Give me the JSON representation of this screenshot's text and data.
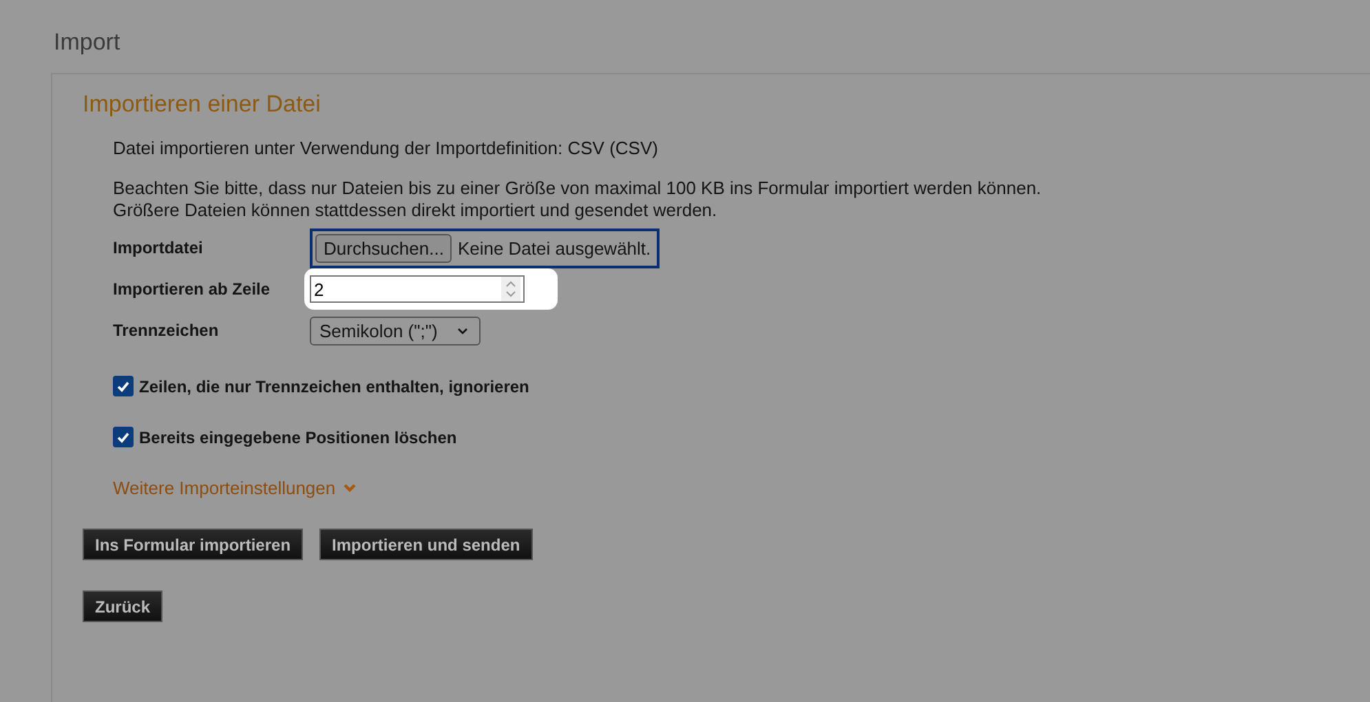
{
  "page_title": "Import",
  "panel": {
    "title": "Importieren einer Datei",
    "intro": "Datei importieren unter Verwendung der Importdefinition: CSV (CSV)",
    "notice": [
      "Beachten Sie bitte, dass nur Dateien bis zu einer Größe von maximal 100 KB ins Formular importiert werden können.",
      "Größere Dateien können stattdessen direkt importiert und gesendet werden."
    ],
    "fields": [
      {
        "kind": "file",
        "label": "Importdatei",
        "button": "Durchsuchen...",
        "value": "Keine Datei ausgewählt.",
        "focused": true,
        "highlighted": false
      },
      {
        "kind": "number",
        "label": "Importieren ab Zeile",
        "value": "2",
        "highlighted": true
      },
      {
        "kind": "select",
        "label": "Trennzeichen",
        "value": "Semikolon (\";\")",
        "highlighted": false
      }
    ],
    "checkboxes": [
      {
        "label": "Zeilen, die nur Trennzeichen enthalten, ignorieren",
        "checked": true
      },
      {
        "label": "Bereits eingegebene Positionen löschen",
        "checked": true
      }
    ],
    "more_link": {
      "label": "Weitere Importeinstellungen",
      "expanded": false
    },
    "buttons": [
      "Ins Formular importieren",
      "Importieren und senden"
    ],
    "back_button": "Zurück"
  }
}
